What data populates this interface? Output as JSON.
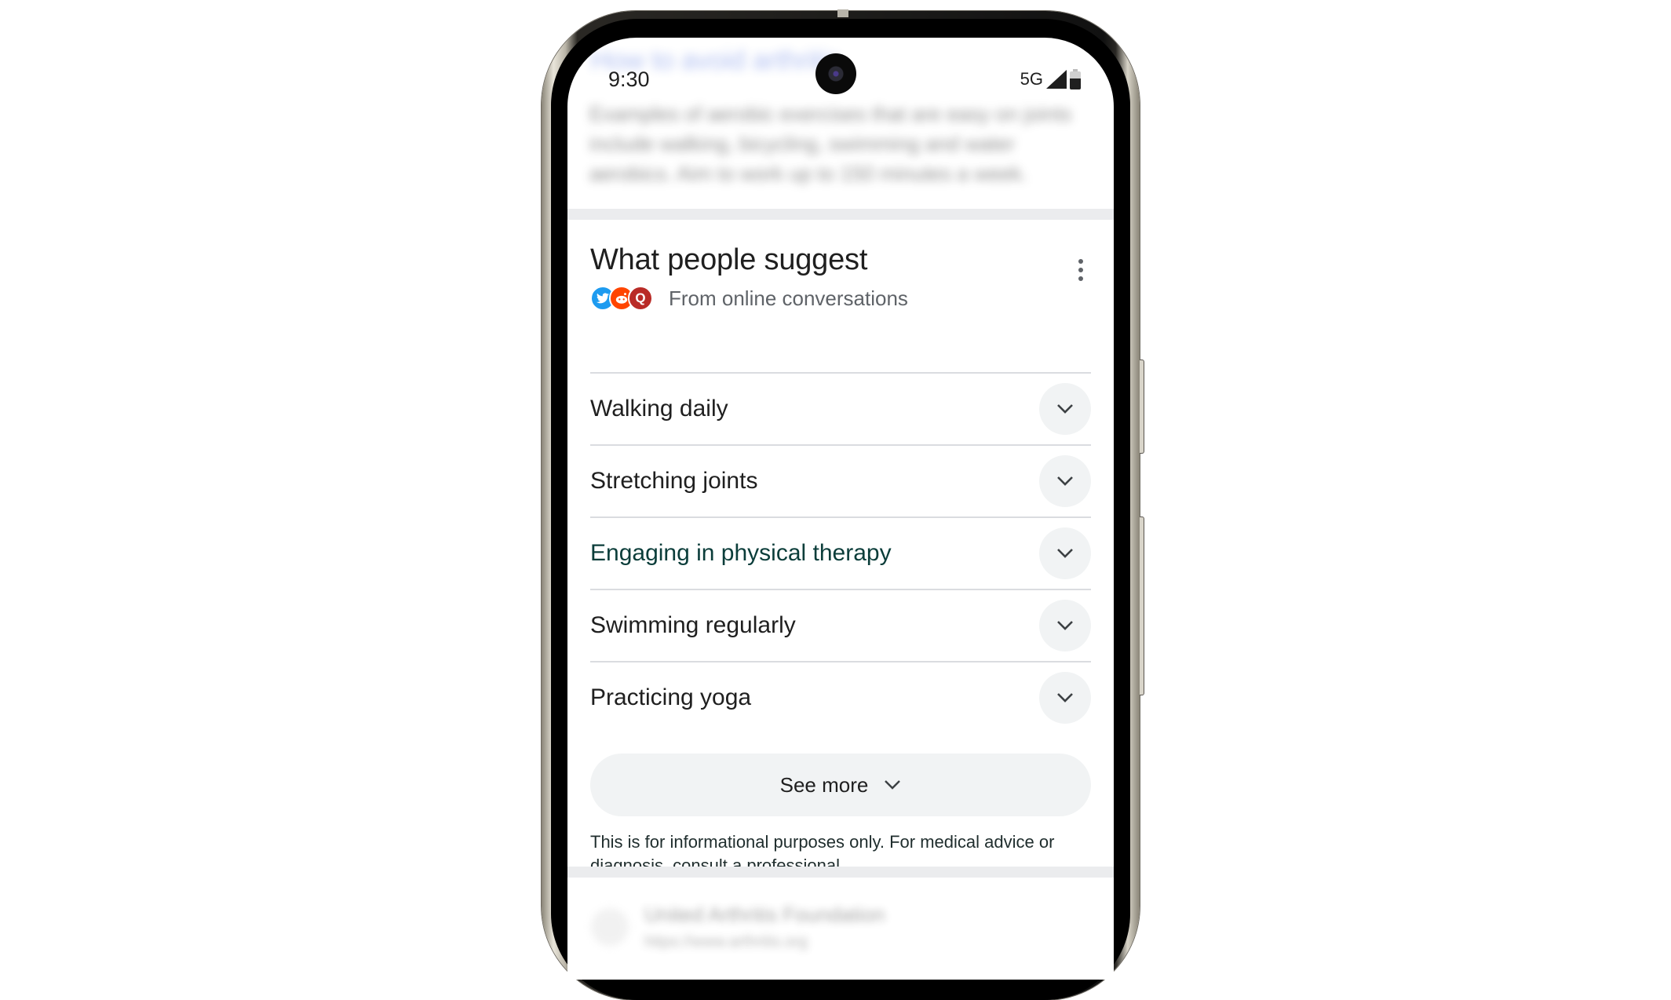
{
  "statusbar": {
    "time": "9:30",
    "network": "5G",
    "battery_level_fraction": 0.6
  },
  "background_blurred": {
    "title": "How to avoid arthritis",
    "snippet": "Examples of aerobic exercises that are easy on joints include walking, bicycling, swimming and water aerobics. Aim to work up to 150 minutes a week.",
    "next_result_site": "United Arthritis Foundation",
    "next_result_url": "https://www.arthritis.org"
  },
  "card": {
    "title": "What people suggest",
    "subtitle": "From online conversations",
    "sources": [
      {
        "name": "twitter-icon",
        "glyph": "🐦"
      },
      {
        "name": "reddit-icon",
        "glyph": "•"
      },
      {
        "name": "quora-icon",
        "glyph": "Q"
      }
    ],
    "items": [
      {
        "label": "Walking daily"
      },
      {
        "label": "Stretching joints"
      },
      {
        "label": "Engaging in physical therapy"
      },
      {
        "label": "Swimming regularly"
      },
      {
        "label": "Practicing yoga"
      }
    ],
    "see_more_label": "See more",
    "disclaimer": "This is for informational purposes only. For medical advice or diagnosis, consult a professional."
  },
  "colors": {
    "text_primary": "#1f1f1f",
    "text_secondary": "#5f6368",
    "chip_bg": "#f1f3f4",
    "divider": "#dadce0",
    "twitter": "#1d9bf0",
    "reddit": "#ff4500",
    "quora": "#b92b27"
  }
}
